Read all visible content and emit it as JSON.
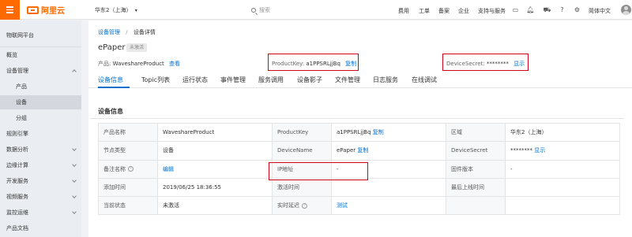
{
  "topbar": {
    "logo_text": "阿里云",
    "region": "华东2（上海）",
    "search_placeholder": "搜索",
    "nav": [
      "费用",
      "工单",
      "备案",
      "企业",
      "支持与服务"
    ],
    "language": "简体中文"
  },
  "sidebar": {
    "title": "物联网平台",
    "items": [
      {
        "label": "概览"
      },
      {
        "label": "设备管理"
      },
      {
        "label": "产品"
      },
      {
        "label": "设备"
      },
      {
        "label": "分组"
      },
      {
        "label": "规则引擎"
      },
      {
        "label": "数据分析"
      },
      {
        "label": "边缘计算"
      },
      {
        "label": "开发服务"
      },
      {
        "label": "视频服务"
      },
      {
        "label": "监控运维"
      },
      {
        "label": "产品文档"
      }
    ]
  },
  "breadcrumb": {
    "parent": "设备管理",
    "separator": "/",
    "current": "设备详情"
  },
  "device": {
    "name": "ePaper",
    "status_badge": "未激活",
    "product_label": "产品:",
    "product_value": "WaveshareProduct",
    "product_action": "查看",
    "productkey_label": "ProductKey:",
    "productkey_value": "a1PPSRLjjBq",
    "productkey_action": "复制",
    "devicesecret_label": "DeviceSecret:",
    "devicesecret_value": "********",
    "devicesecret_action": "显示"
  },
  "tabs": [
    "设备信息",
    "Topic列表",
    "运行状态",
    "事件管理",
    "服务调用",
    "设备影子",
    "文件管理",
    "日志服务",
    "在线调试"
  ],
  "section_title": "设备信息",
  "info": {
    "r1": {
      "k1": "产品名称",
      "v1": "WaveshareProduct",
      "k2": "ProductKey",
      "v2": "a1PPSRLjjBq",
      "a2": "复制",
      "k3": "区域",
      "v3": "华东2（上海）"
    },
    "r2": {
      "k1": "节点类型",
      "v1": "设备",
      "k2": "DeviceName",
      "v2": "ePaper",
      "a2": "复制",
      "k3": "DeviceSecret",
      "v3": "********",
      "a3": "显示"
    },
    "r3": {
      "k1": "备注名称",
      "q1": "?",
      "v1": "编辑",
      "k2": "IP地址",
      "v2": "-",
      "k3": "固件版本",
      "v3": "-"
    },
    "r4": {
      "k1": "添加时间",
      "v1": "2019/06/25 18:36:55",
      "k2": "激活时间",
      "v2": "",
      "k3": "最后上线时间",
      "v3": ""
    },
    "r5": {
      "k1": "当前状态",
      "v1": "未激活",
      "k2": "实时延迟",
      "q2": "?",
      "v2": "测试",
      "k3": "",
      "v3": ""
    }
  }
}
